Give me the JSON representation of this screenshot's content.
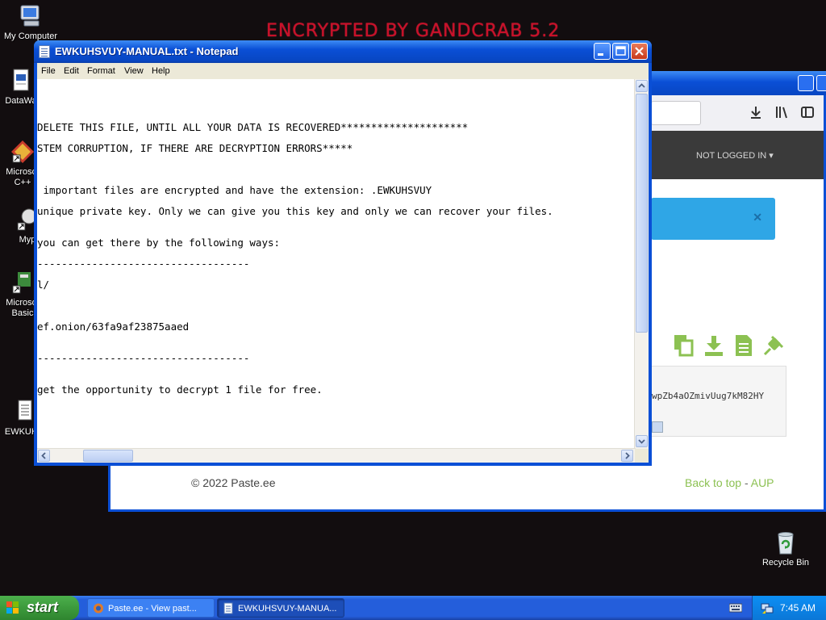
{
  "desktop": {
    "wallpaper_text": "ENCRYPTED BY GANDCRAB 5.2",
    "icons": [
      {
        "label": "My Computer",
        "icon": "my-computer-icon"
      },
      {
        "label": "DataWa",
        "icon": "document-icon"
      },
      {
        "label": "Microsof C++",
        "icon": "shortcut-icon"
      },
      {
        "label": "Myp",
        "icon": "shortcut-icon"
      },
      {
        "label": "Microsof Basic",
        "icon": "shortcut-icon"
      },
      {
        "label": "EWKUHS",
        "icon": "text-file-icon"
      },
      {
        "label": "Recycle Bin",
        "icon": "recycle-bin-icon"
      }
    ]
  },
  "browser": {
    "login_status": "NOT LOGGED IN",
    "code_snippet": "wpZb4aOZmivUug7kM82HY",
    "footer_copyright": "© 2022 Paste.ee",
    "footer_links": [
      "Back to top",
      "AUP"
    ],
    "footer_separator": "-",
    "accent_color": "#8cc152",
    "alert_color": "#2fa6e6"
  },
  "notepad": {
    "title": "EWKUHSVUY-MANUAL.txt - Notepad",
    "menu": [
      "File",
      "Edit",
      "Format",
      "View",
      "Help"
    ],
    "lines": [
      "DELETE THIS FILE, UNTIL ALL YOUR DATA IS RECOVERED*********************",
      "STEM CORRUPTION, IF THERE ARE DECRYPTION ERRORS*****",
      " important files are encrypted and have the extension: .EWKUHSVUY",
      "unique private key. Only we can give you this key and only we can recover your files.",
      "you can get there by the following ways:",
      "-----------------------------------",
      "l/",
      "ef.onion/63fa9af23875aaed",
      "-----------------------------------",
      "get the opportunity to decrypt 1 file for free."
    ]
  },
  "taskbar": {
    "start_label": "start",
    "tasks": [
      {
        "label": "Paste.ee - View past...",
        "active": false
      },
      {
        "label": "EWKUHSVUY-MANUA...",
        "active": true
      }
    ],
    "clock": "7:45 AM"
  }
}
